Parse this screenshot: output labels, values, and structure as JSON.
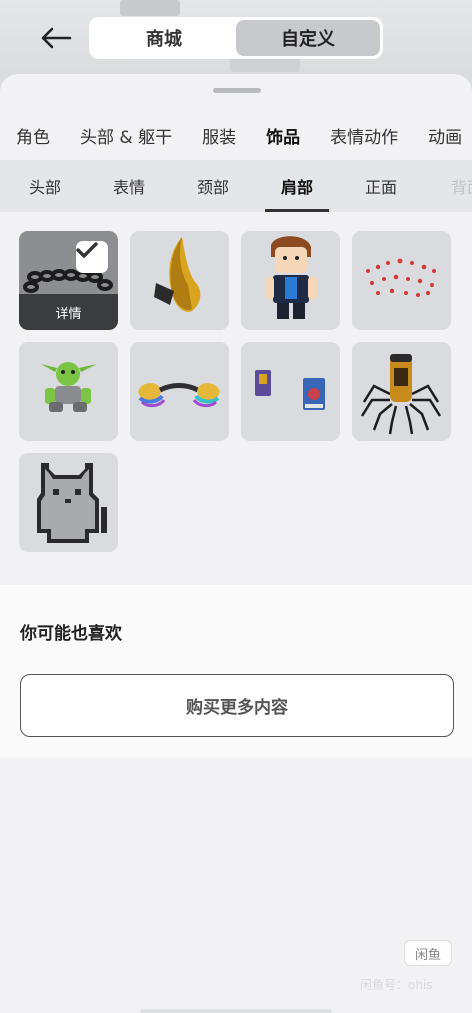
{
  "header": {
    "back_icon": "arrow-left-icon",
    "segments": [
      {
        "label": "商城",
        "active": false
      },
      {
        "label": "自定义",
        "active": true
      }
    ]
  },
  "categories": [
    {
      "label": "角色",
      "active": false
    },
    {
      "label": "头部 & 躯干",
      "active": false
    },
    {
      "label": "服装",
      "active": false
    },
    {
      "label": "饰品",
      "active": true
    },
    {
      "label": "表情动作",
      "active": false
    },
    {
      "label": "动画",
      "active": false
    }
  ],
  "subcategories": [
    {
      "label": "头部",
      "active": false
    },
    {
      "label": "表情",
      "active": false
    },
    {
      "label": "颈部",
      "active": false
    },
    {
      "label": "肩部",
      "active": true
    },
    {
      "label": "正面",
      "active": false
    },
    {
      "label": "背面",
      "active": false
    }
  ],
  "items": [
    {
      "name": "chain-necklace",
      "selected": true,
      "detail_label": "详情",
      "check_icon": "checkmark-icon"
    },
    {
      "name": "golden-shoulder-horn",
      "selected": false
    },
    {
      "name": "shoulder-buddy-figure",
      "selected": false
    },
    {
      "name": "floating-hearts",
      "selected": false
    },
    {
      "name": "green-goblin-pal",
      "selected": false
    },
    {
      "name": "rainbow-pads",
      "selected": false
    },
    {
      "name": "shoulder-cards",
      "selected": false
    },
    {
      "name": "spider-jar",
      "selected": false
    },
    {
      "name": "pixel-cat",
      "selected": false
    }
  ],
  "recommendations": {
    "title": "你可能也喜欢",
    "buy_more_label": "购买更多内容"
  },
  "watermark": {
    "box_text": "闲鱼",
    "text": "闲鱼号：ohis"
  },
  "colors": {
    "selected_tile": "#8d8e91",
    "tile": "#dadbde",
    "detail_bar": "#3b3c3f"
  }
}
